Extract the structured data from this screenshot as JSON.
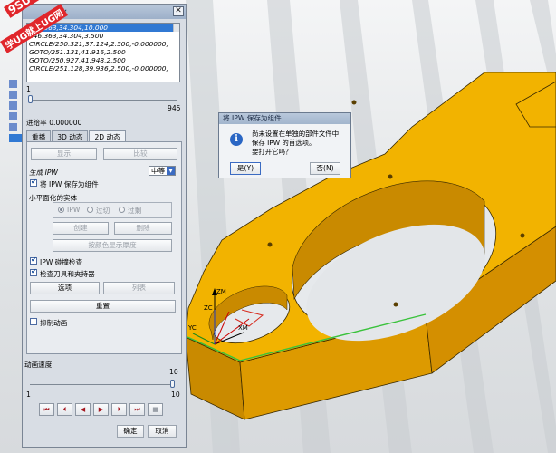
{
  "watermark": {
    "line1": "9SUG",
    "line2": "学UG就上UG网"
  },
  "dialog": {
    "title": "化",
    "close_icon": "close-icon",
    "path_list": [
      "246.363,34.304,10.000",
      "246.363,34.304,3.500",
      "CIRCLE/250.321,37.124,2.500,-0.000000,",
      "GOTO/251.131,41.916,2.500",
      "GOTO/250.927,41.948,2.500",
      "CIRCLE/251.128,39.936,2.500,-0.000000,"
    ],
    "slider_min": "1",
    "slider_max": "945",
    "feed_label": "进给率 0.000000",
    "tabs": [
      "重播",
      "3D 动态",
      "2D 动态"
    ],
    "panel": {
      "display_button": "显示",
      "compare_button": "比较",
      "generate_ipw_label": "生成 IPW",
      "generate_ipw_value": "中等",
      "save_ipw_checkbox": "将 IPW 保存为组件",
      "min_body_label": "小平面化的实体",
      "radio_ipw": "IPW",
      "radio_undercut": "过切",
      "radio_overcut": "过剩",
      "create_button": "创建",
      "delete_button": "删除",
      "color_button": "按颜色显示厚度",
      "collision_check": "IPW 碰撞检查",
      "check_tool_holder": "检查刀具和夹持器",
      "options_button": "选项",
      "list_button": "列表",
      "reset_button": "重置",
      "suppress_animation": "抑制动画"
    },
    "anim_speed_label": "动画速度",
    "anim_slider_value": "10",
    "anim_min": "1",
    "anim_max": "10",
    "ok_button": "确定",
    "cancel_button": "取消"
  },
  "popup": {
    "title": "将 IPW 保存为组件",
    "message_lines": [
      "尚未设置在单独的部件文件中",
      "保存 IPW 的首选项。",
      "要打开它吗？"
    ],
    "yes_button": "是(Y)",
    "no_button": "否(N)"
  },
  "axes": {
    "z_label": "ZM",
    "x_label": "XM",
    "zc_label": "ZC",
    "yc_label": "YC"
  },
  "colors": {
    "part_top": "#f2b300",
    "part_side": "#d99400",
    "part_edge": "#3a2a00",
    "selection": "#3179d3"
  }
}
